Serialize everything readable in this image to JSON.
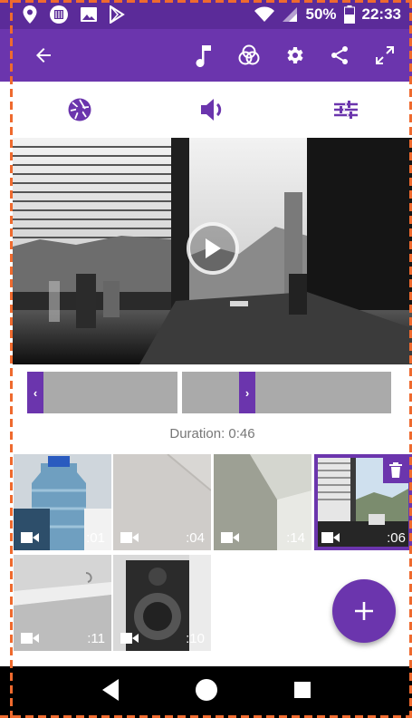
{
  "status_bar": {
    "battery": "50%",
    "time": "22:33",
    "icons": [
      "location-icon",
      "sim-icon",
      "image-icon",
      "play-store-icon",
      "wifi-icon",
      "signal-icon",
      "battery-icon"
    ]
  },
  "toolbar": {
    "icons": [
      "back-arrow-icon",
      "music-note-icon",
      "filter-icon",
      "settings-icon",
      "share-icon",
      "fullscreen-icon"
    ]
  },
  "tabs": [
    "aperture-icon",
    "volume-icon",
    "sliders-icon"
  ],
  "player": {
    "icon": "play-icon"
  },
  "trimmer": {
    "left_handle": "‹",
    "right_handle": "›"
  },
  "duration_label": "Duration: 0:46",
  "clips": [
    {
      "duration": ":01",
      "selected": false
    },
    {
      "duration": ":04",
      "selected": false
    },
    {
      "duration": ":14",
      "selected": false
    },
    {
      "duration": ":06",
      "selected": true
    },
    {
      "duration": ":11",
      "selected": false
    },
    {
      "duration": ":10",
      "selected": false
    }
  ],
  "fab": {
    "label": "+"
  },
  "colors": {
    "primary": "#6b35ad",
    "status_bar": "#5b2b99",
    "accent_outline": "#ef6a2e"
  }
}
